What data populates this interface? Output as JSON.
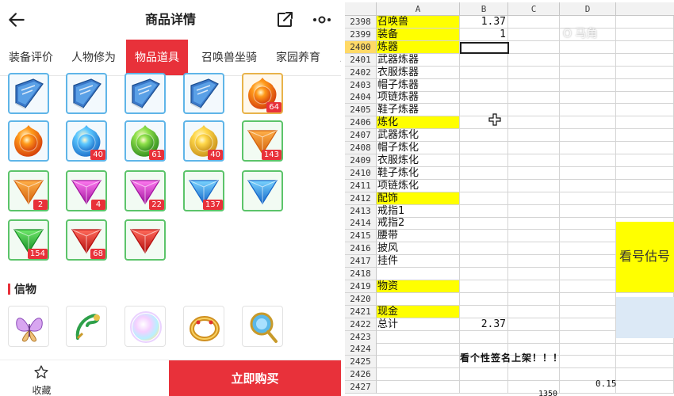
{
  "phone": {
    "title": "商品详情",
    "tabs": [
      {
        "label": "装备评价",
        "active": false
      },
      {
        "label": "人物修为",
        "active": false
      },
      {
        "label": "物品道具",
        "active": true
      },
      {
        "label": "召唤兽坐骑",
        "active": false
      },
      {
        "label": "家园养育",
        "active": false
      },
      {
        "label": "房",
        "active": false
      }
    ],
    "items": [
      {
        "icon": "blue-book-icon",
        "quality": "blue",
        "count": ""
      },
      {
        "icon": "blue-book-icon",
        "quality": "blue",
        "count": ""
      },
      {
        "icon": "blue-book-icon",
        "quality": "blue",
        "count": ""
      },
      {
        "icon": "blue-book-icon",
        "quality": "blue",
        "count": ""
      },
      {
        "icon": "fire-orb-icon",
        "quality": "orange",
        "count": "64"
      },
      {
        "icon": "fire-orb-icon",
        "quality": "blue",
        "count": ""
      },
      {
        "icon": "water-orb-icon",
        "quality": "blue",
        "count": "40"
      },
      {
        "icon": "green-orb-icon",
        "quality": "blue",
        "count": "61"
      },
      {
        "icon": "gold-orb-icon",
        "quality": "blue",
        "count": "40"
      },
      {
        "icon": "orange-gem-icon",
        "quality": "green",
        "count": "143"
      },
      {
        "icon": "orange-gem-icon",
        "quality": "green",
        "count": "2"
      },
      {
        "icon": "purple-gem-icon",
        "quality": "green",
        "count": "4"
      },
      {
        "icon": "purple-gem-icon",
        "quality": "green",
        "count": "22"
      },
      {
        "icon": "blue-gem-icon",
        "quality": "green",
        "count": "137"
      },
      {
        "icon": "blue-gem-icon",
        "quality": "green",
        "count": ""
      },
      {
        "icon": "green-gem-icon",
        "quality": "green",
        "count": "154"
      },
      {
        "icon": "red-gem-icon",
        "quality": "green",
        "count": "68"
      },
      {
        "icon": "red-gem-icon",
        "quality": "green",
        "count": ""
      }
    ],
    "section_title": "信物",
    "tokens": [
      {
        "icon": "butterfly-icon"
      },
      {
        "icon": "jade-hook-icon"
      },
      {
        "icon": "rainbow-orb-icon"
      },
      {
        "icon": "gold-ring-icon"
      },
      {
        "icon": "mirror-icon"
      }
    ],
    "favorite_label": "收藏",
    "buy_label": "立即购买",
    "accent": "#e8313a"
  },
  "sheet": {
    "columns": [
      "A",
      "B",
      "C",
      "D"
    ],
    "rows": [
      {
        "n": "2398",
        "a": "召唤兽",
        "b": "1.37",
        "hl": true
      },
      {
        "n": "2399",
        "a": "装备",
        "b": "1",
        "hl": true
      },
      {
        "n": "2400",
        "a": "炼器",
        "b": "",
        "hl": true
      },
      {
        "n": "2401",
        "a": "武器炼器",
        "b": "",
        "hl": false
      },
      {
        "n": "2402",
        "a": "衣服炼器",
        "b": "",
        "hl": false
      },
      {
        "n": "2403",
        "a": "帽子炼器",
        "b": "",
        "hl": false
      },
      {
        "n": "2404",
        "a": "项链炼器",
        "b": "",
        "hl": false
      },
      {
        "n": "2405",
        "a": "鞋子炼器",
        "b": "",
        "hl": false
      },
      {
        "n": "2406",
        "a": "炼化",
        "b": "",
        "hl": true
      },
      {
        "n": "2407",
        "a": "武器炼化",
        "b": "",
        "hl": false
      },
      {
        "n": "2408",
        "a": "帽子炼化",
        "b": "",
        "hl": false
      },
      {
        "n": "2409",
        "a": "衣服炼化",
        "b": "",
        "hl": false
      },
      {
        "n": "2410",
        "a": "鞋子炼化",
        "b": "",
        "hl": false
      },
      {
        "n": "2411",
        "a": "项链炼化",
        "b": "",
        "hl": false
      },
      {
        "n": "2412",
        "a": "配饰",
        "b": "",
        "hl": true
      },
      {
        "n": "2413",
        "a": "戒指1",
        "b": "",
        "hl": false
      },
      {
        "n": "2414",
        "a": "戒指2",
        "b": "",
        "hl": false
      },
      {
        "n": "2415",
        "a": "腰带",
        "b": "",
        "hl": false
      },
      {
        "n": "2416",
        "a": "披风",
        "b": "",
        "hl": false
      },
      {
        "n": "2417",
        "a": "挂件",
        "b": "",
        "hl": false
      },
      {
        "n": "2418",
        "a": "",
        "b": "",
        "hl": false
      },
      {
        "n": "2419",
        "a": "物资",
        "b": "",
        "hl": true
      },
      {
        "n": "2420",
        "a": "",
        "b": "",
        "hl": false
      },
      {
        "n": "2421",
        "a": "现金",
        "b": "",
        "hl": true
      },
      {
        "n": "2422",
        "a": "总计",
        "b": "2.37",
        "hl": false
      },
      {
        "n": "2423",
        "a": "",
        "b": "",
        "hl": false
      },
      {
        "n": "2424",
        "a": "",
        "b": "",
        "hl": false
      },
      {
        "n": "2425",
        "a": "",
        "b": "",
        "hl": false
      },
      {
        "n": "2426",
        "a": "",
        "b": "",
        "hl": false
      },
      {
        "n": "2427",
        "a": "",
        "b": "",
        "hl": false
      }
    ],
    "selected_row": "2400",
    "note_text": "看号估号",
    "banner_text": "看个性签名上架！！！",
    "value_d2426": "0.15",
    "value_c2427": "1350",
    "watermark": "O 马角",
    "highlight_color": "#ffff00"
  }
}
